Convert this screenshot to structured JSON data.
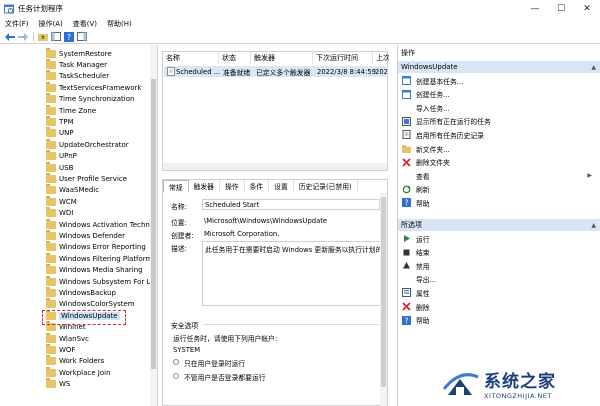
{
  "window": {
    "title": "任务计划程序",
    "controls": [
      "—",
      "☐",
      "✕"
    ]
  },
  "menu": [
    "文件(F)",
    "操作(A)",
    "查看(V)",
    "帮助(H)"
  ],
  "tree": {
    "items": [
      "SystemRestore",
      "Task Manager",
      "TaskScheduler",
      "TextServicesFramework",
      "Time Synchronization",
      "Time Zone",
      "TPM",
      "UNP",
      "UpdateOrchestrator",
      "UPnP",
      "USB",
      "User Profile Service",
      "WaaSMedic",
      "WCM",
      "WDI",
      "Windows Activation Techn",
      "Windows Defender",
      "Windows Error Reporting",
      "Windows Filtering Platform",
      "Windows Media Sharing",
      "Windows Subsystem For Li",
      "WindowsBackup",
      "WindowsColorSystem",
      "WindowsUpdate",
      "Wininet",
      "WlanSvc",
      "WOF",
      "Work Folders",
      "Workplace Join",
      "WS"
    ],
    "selected": "WindowsUpdate"
  },
  "tasklist": {
    "columns": [
      "名称",
      "状态",
      "触发器",
      "下次运行时间",
      "上次运行时"
    ],
    "rows": [
      {
        "name": "Scheduled ...",
        "status": "准备就绪",
        "trigger": "已定义多个触发器",
        "next_run": "2022/3/8 8:44:59",
        "last_run": "2022/3/8"
      }
    ]
  },
  "details": {
    "tabs": [
      "常规",
      "触发器",
      "操作",
      "条件",
      "设置",
      "历史记录(已禁用)"
    ],
    "name_label": "名称:",
    "name_value": "Scheduled Start",
    "location_label": "位置:",
    "location_value": "\\Microsoft\\Windows\\WindowsUpdate",
    "author_label": "创建者:",
    "author_value": "Microsoft Corporation.",
    "desc_label": "描述:",
    "desc_value": "此任务用于在需要时启动 Windows 更新服务以执行计划的",
    "security_title": "安全选项",
    "run_as_text": "运行任务时，请使用下列用户帐户:",
    "account": "SYSTEM",
    "option1": "只在用户登录时运行",
    "option2": "不管用户是否登录都要运行"
  },
  "actions": {
    "header": "操作",
    "group1_title": "WindowsUpdate",
    "group1": [
      "创建基本任务...",
      "创建任务...",
      "导入任务...",
      "显示所有正在运行的任务",
      "启用所有任务历史记录",
      "新文件夹...",
      "删除文件夹",
      "查看",
      "刷新",
      "帮助"
    ],
    "group2_title": "所选项",
    "group2": [
      "运行",
      "结束",
      "禁用",
      "导出...",
      "属性",
      "删除",
      "帮助"
    ]
  },
  "watermark": {
    "cn": "系统之家",
    "en": "XITONGZHIJIA.NET"
  },
  "colors": {
    "selection": "#d9e8f7",
    "actions_header": "#d6e6f5",
    "highlight_box": "#d62828",
    "folder": "#e8c468"
  }
}
